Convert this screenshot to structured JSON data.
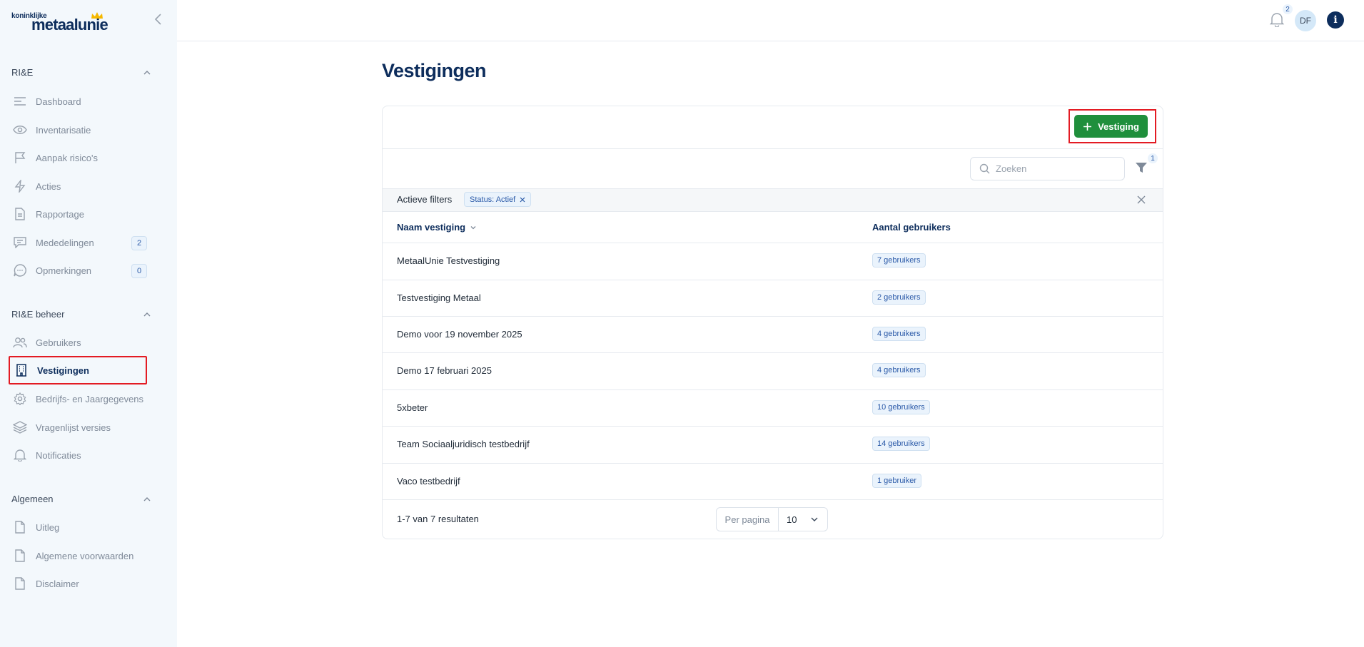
{
  "brand": {
    "small": "koninklijke",
    "big": "metaalunie"
  },
  "sidebar": {
    "sections": [
      {
        "title": "RI&E"
      },
      {
        "title": "RI&E beheer"
      },
      {
        "title": "Algemeen"
      }
    ],
    "items": [
      {
        "label": "Dashboard",
        "icon": "menu-lines-icon"
      },
      {
        "label": "Inventarisatie",
        "icon": "eye-icon"
      },
      {
        "label": "Aanpak risico's",
        "icon": "flag-icon"
      },
      {
        "label": "Acties",
        "icon": "lightning-icon"
      },
      {
        "label": "Rapportage",
        "icon": "document-icon"
      },
      {
        "label": "Mededelingen",
        "icon": "message-icon",
        "badge": "2"
      },
      {
        "label": "Opmerkingen",
        "icon": "chat-dots-icon",
        "badge": "0"
      },
      {
        "label": "Gebruikers",
        "icon": "users-icon"
      },
      {
        "label": "Vestigingen",
        "icon": "building-icon",
        "active": true
      },
      {
        "label": "Bedrijfs- en Jaargegevens",
        "icon": "gear-icon"
      },
      {
        "label": "Vragenlijst versies",
        "icon": "layers-icon"
      },
      {
        "label": "Notificaties",
        "icon": "bell-icon"
      },
      {
        "label": "Uitleg",
        "icon": "file-icon"
      },
      {
        "label": "Algemene voorwaarden",
        "icon": "file-icon"
      },
      {
        "label": "Disclaimer",
        "icon": "file-icon"
      }
    ]
  },
  "topbar": {
    "notifications_count": "2",
    "avatar_initials": "DF",
    "info_label": "i"
  },
  "page": {
    "title": "Vestigingen",
    "add_button_label": "Vestiging"
  },
  "toolbar": {
    "search_placeholder": "Zoeken",
    "filter_count": "1"
  },
  "filters": {
    "label": "Actieve filters",
    "chips": [
      {
        "label": "Status: Actief"
      }
    ]
  },
  "table": {
    "columns": [
      "Naam vestiging",
      "Aantal gebruikers"
    ],
    "rows": [
      {
        "name": "MetaalUnie Testvestiging",
        "users": "7 gebruikers"
      },
      {
        "name": "Testvestiging Metaal",
        "users": "2 gebruikers"
      },
      {
        "name": "Demo voor 19 november 2025",
        "users": "4 gebruikers"
      },
      {
        "name": "Demo 17 februari 2025",
        "users": "4 gebruikers"
      },
      {
        "name": "5xbeter",
        "users": "10 gebruikers"
      },
      {
        "name": "Team Sociaaljuridisch testbedrijf",
        "users": "14 gebruikers"
      },
      {
        "name": "Vaco testbedrijf",
        "users": "1 gebruiker"
      }
    ]
  },
  "pagination": {
    "results_text": "1-7 van 7 resultaten",
    "per_page_label": "Per pagina",
    "per_page_value": "10"
  },
  "colors": {
    "primary": "#0d2d5c",
    "accent_green": "#1f8f3c",
    "highlight_red": "#e31b23",
    "badge_blue": "#2b5aa8",
    "sidebar_bg": "#f3f8fc"
  }
}
